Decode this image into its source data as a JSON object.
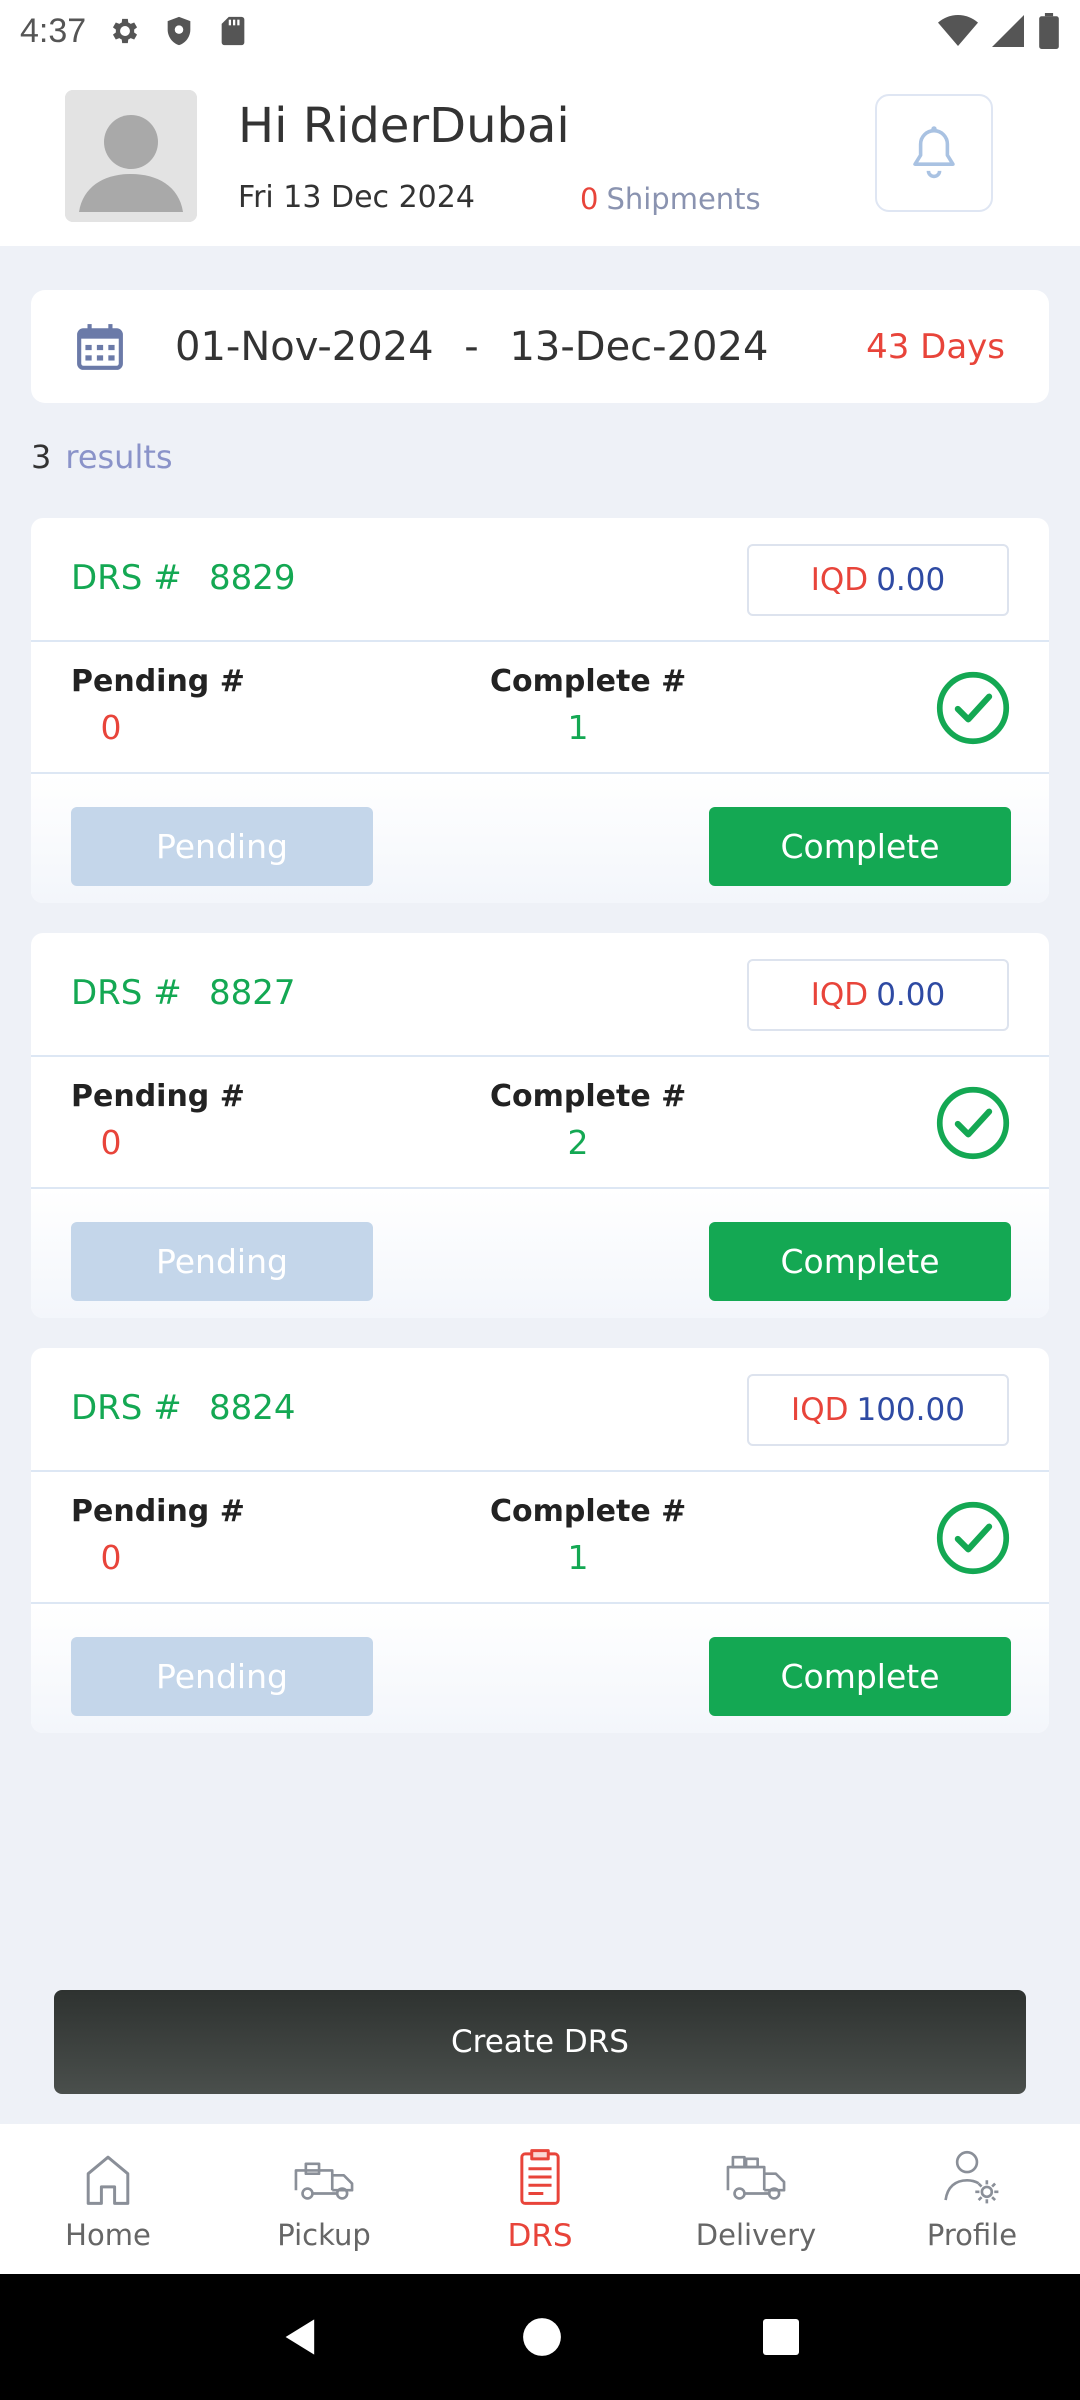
{
  "status_bar": {
    "time": "4:37"
  },
  "header": {
    "greeting": "Hi RiderDubai",
    "date": "Fri 13 Dec 2024",
    "shipments_count": "0",
    "shipments_label": "Shipments"
  },
  "date_range": {
    "from": "01-Nov-2024",
    "separator": "-",
    "to": "13-Dec-2024",
    "days": "43 Days"
  },
  "results": {
    "count": "3",
    "label": "results"
  },
  "labels": {
    "drs_prefix": "DRS #",
    "currency": "IQD",
    "pending_label": "Pending #",
    "complete_label": "Complete #",
    "pending_button": "Pending",
    "complete_button": "Complete"
  },
  "cards": [
    {
      "drs_number": "8829",
      "amount": "0.00",
      "pending": "0",
      "complete": "1"
    },
    {
      "drs_number": "8827",
      "amount": "0.00",
      "pending": "0",
      "complete": "2"
    },
    {
      "drs_number": "8824",
      "amount": "100.00",
      "pending": "0",
      "complete": "1"
    }
  ],
  "create_button": "Create DRS",
  "nav": {
    "items": [
      {
        "label": "Home",
        "icon": "home-icon"
      },
      {
        "label": "Pickup",
        "icon": "truck-icon"
      },
      {
        "label": "DRS",
        "icon": "clipboard-icon",
        "active": true
      },
      {
        "label": "Delivery",
        "icon": "delivery-truck-icon"
      },
      {
        "label": "Profile",
        "icon": "profile-settings-icon"
      }
    ]
  },
  "colors": {
    "accent_red": "#e8443a",
    "accent_green": "#14a853",
    "amount_blue": "#2e4aa3",
    "pending_button": "#c4d6ea"
  }
}
